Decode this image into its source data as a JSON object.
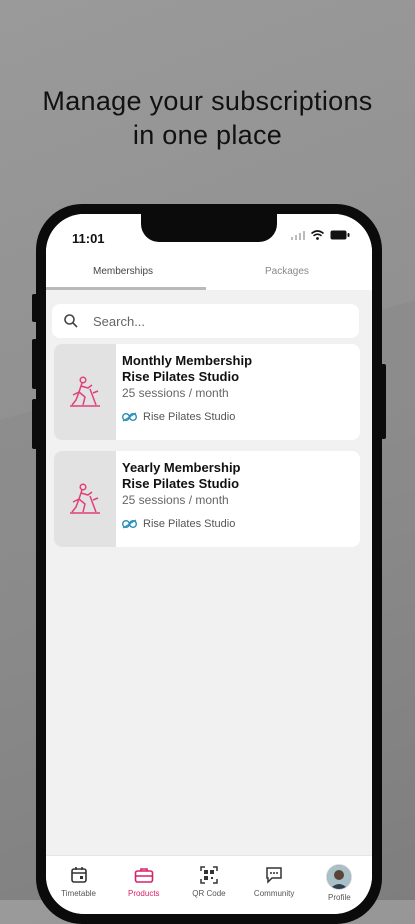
{
  "headline": {
    "line1": "Manage your subscriptions",
    "line2": "in one place"
  },
  "status_bar": {
    "time": "11:01"
  },
  "tabs": [
    {
      "label": "Memberships",
      "active": true
    },
    {
      "label": "Packages",
      "active": false
    }
  ],
  "search": {
    "placeholder": "Search..."
  },
  "cards": [
    {
      "title_line1": "Monthly Membership",
      "title_line2": "Rise Pilates Studio",
      "sessions": "25 sessions / month",
      "studio": "Rise Pilates Studio",
      "icon": "pilates-icon"
    },
    {
      "title_line1": "Yearly Membership",
      "title_line2": "Rise Pilates Studio",
      "sessions": "25 sessions / month",
      "studio": "Rise Pilates Studio",
      "icon": "pilates-icon"
    }
  ],
  "bottom_nav": [
    {
      "label": "Timetable",
      "icon": "calendar-icon",
      "active": false
    },
    {
      "label": "Products",
      "icon": "briefcase-icon",
      "active": true
    },
    {
      "label": "QR Code",
      "icon": "qr-code-icon",
      "active": false
    },
    {
      "label": "Community",
      "icon": "chat-icon",
      "active": false
    },
    {
      "label": "Profile",
      "icon": "avatar",
      "active": false
    }
  ],
  "colors": {
    "accent": "#d6226b",
    "studio_logo": "#2a8fb5"
  }
}
